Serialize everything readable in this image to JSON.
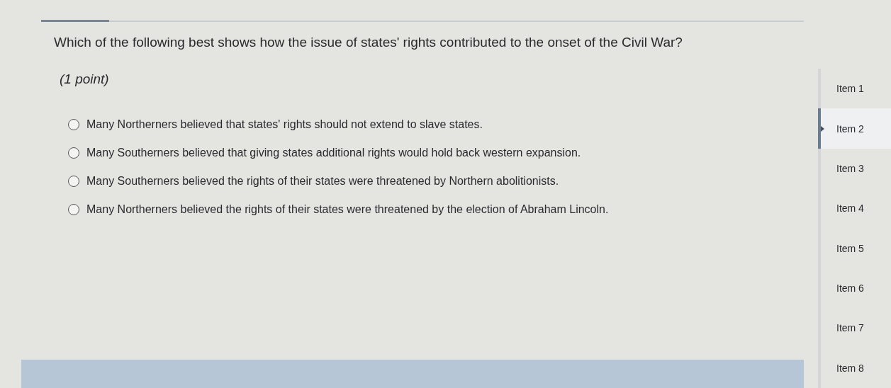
{
  "question": {
    "text": "Which of the following best shows how the issue of states' rights contributed to the onset of the Civil War?",
    "points": "(1 point)"
  },
  "options": [
    {
      "label": "Many Northerners believed that states' rights should not extend to slave states.",
      "selected": false
    },
    {
      "label": "Many Southerners believed that giving states additional rights would hold back western expansion.",
      "selected": false
    },
    {
      "label": "Many Southerners believed the rights of their states were threatened by Northern abolitionists.",
      "selected": false
    },
    {
      "label": "Many Northerners believed the rights of their states were threatened by the election of Abraham Lincoln.",
      "selected": false
    }
  ],
  "sidebar": {
    "items": [
      {
        "label": "Item 1",
        "selected": false
      },
      {
        "label": "Item 2",
        "selected": true
      },
      {
        "label": "Item 3",
        "selected": false
      },
      {
        "label": "Item 4",
        "selected": false
      },
      {
        "label": "Item 5",
        "selected": false
      },
      {
        "label": "Item 6",
        "selected": false
      },
      {
        "label": "Item 7",
        "selected": false
      },
      {
        "label": "Item 8",
        "selected": false
      }
    ]
  }
}
